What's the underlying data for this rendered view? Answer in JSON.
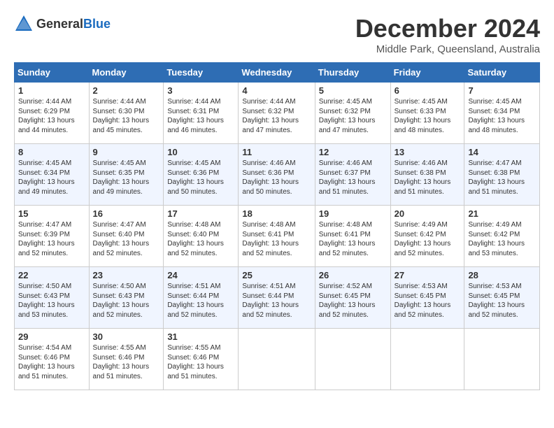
{
  "header": {
    "logo_general": "General",
    "logo_blue": "Blue",
    "title": "December 2024",
    "location": "Middle Park, Queensland, Australia"
  },
  "calendar": {
    "days_of_week": [
      "Sunday",
      "Monday",
      "Tuesday",
      "Wednesday",
      "Thursday",
      "Friday",
      "Saturday"
    ],
    "weeks": [
      [
        {
          "day": "",
          "content": ""
        },
        {
          "day": "2",
          "content": "Sunrise: 4:44 AM\nSunset: 6:30 PM\nDaylight: 13 hours\nand 45 minutes."
        },
        {
          "day": "3",
          "content": "Sunrise: 4:44 AM\nSunset: 6:31 PM\nDaylight: 13 hours\nand 46 minutes."
        },
        {
          "day": "4",
          "content": "Sunrise: 4:44 AM\nSunset: 6:32 PM\nDaylight: 13 hours\nand 47 minutes."
        },
        {
          "day": "5",
          "content": "Sunrise: 4:45 AM\nSunset: 6:32 PM\nDaylight: 13 hours\nand 47 minutes."
        },
        {
          "day": "6",
          "content": "Sunrise: 4:45 AM\nSunset: 6:33 PM\nDaylight: 13 hours\nand 48 minutes."
        },
        {
          "day": "7",
          "content": "Sunrise: 4:45 AM\nSunset: 6:34 PM\nDaylight: 13 hours\nand 48 minutes."
        }
      ],
      [
        {
          "day": "8",
          "content": "Sunrise: 4:45 AM\nSunset: 6:34 PM\nDaylight: 13 hours\nand 49 minutes."
        },
        {
          "day": "9",
          "content": "Sunrise: 4:45 AM\nSunset: 6:35 PM\nDaylight: 13 hours\nand 49 minutes."
        },
        {
          "day": "10",
          "content": "Sunrise: 4:45 AM\nSunset: 6:36 PM\nDaylight: 13 hours\nand 50 minutes."
        },
        {
          "day": "11",
          "content": "Sunrise: 4:46 AM\nSunset: 6:36 PM\nDaylight: 13 hours\nand 50 minutes."
        },
        {
          "day": "12",
          "content": "Sunrise: 4:46 AM\nSunset: 6:37 PM\nDaylight: 13 hours\nand 51 minutes."
        },
        {
          "day": "13",
          "content": "Sunrise: 4:46 AM\nSunset: 6:38 PM\nDaylight: 13 hours\nand 51 minutes."
        },
        {
          "day": "14",
          "content": "Sunrise: 4:47 AM\nSunset: 6:38 PM\nDaylight: 13 hours\nand 51 minutes."
        }
      ],
      [
        {
          "day": "15",
          "content": "Sunrise: 4:47 AM\nSunset: 6:39 PM\nDaylight: 13 hours\nand 52 minutes."
        },
        {
          "day": "16",
          "content": "Sunrise: 4:47 AM\nSunset: 6:40 PM\nDaylight: 13 hours\nand 52 minutes."
        },
        {
          "day": "17",
          "content": "Sunrise: 4:48 AM\nSunset: 6:40 PM\nDaylight: 13 hours\nand 52 minutes."
        },
        {
          "day": "18",
          "content": "Sunrise: 4:48 AM\nSunset: 6:41 PM\nDaylight: 13 hours\nand 52 minutes."
        },
        {
          "day": "19",
          "content": "Sunrise: 4:48 AM\nSunset: 6:41 PM\nDaylight: 13 hours\nand 52 minutes."
        },
        {
          "day": "20",
          "content": "Sunrise: 4:49 AM\nSunset: 6:42 PM\nDaylight: 13 hours\nand 52 minutes."
        },
        {
          "day": "21",
          "content": "Sunrise: 4:49 AM\nSunset: 6:42 PM\nDaylight: 13 hours\nand 53 minutes."
        }
      ],
      [
        {
          "day": "22",
          "content": "Sunrise: 4:50 AM\nSunset: 6:43 PM\nDaylight: 13 hours\nand 53 minutes."
        },
        {
          "day": "23",
          "content": "Sunrise: 4:50 AM\nSunset: 6:43 PM\nDaylight: 13 hours\nand 52 minutes."
        },
        {
          "day": "24",
          "content": "Sunrise: 4:51 AM\nSunset: 6:44 PM\nDaylight: 13 hours\nand 52 minutes."
        },
        {
          "day": "25",
          "content": "Sunrise: 4:51 AM\nSunset: 6:44 PM\nDaylight: 13 hours\nand 52 minutes."
        },
        {
          "day": "26",
          "content": "Sunrise: 4:52 AM\nSunset: 6:45 PM\nDaylight: 13 hours\nand 52 minutes."
        },
        {
          "day": "27",
          "content": "Sunrise: 4:53 AM\nSunset: 6:45 PM\nDaylight: 13 hours\nand 52 minutes."
        },
        {
          "day": "28",
          "content": "Sunrise: 4:53 AM\nSunset: 6:45 PM\nDaylight: 13 hours\nand 52 minutes."
        }
      ],
      [
        {
          "day": "29",
          "content": "Sunrise: 4:54 AM\nSunset: 6:46 PM\nDaylight: 13 hours\nand 51 minutes."
        },
        {
          "day": "30",
          "content": "Sunrise: 4:55 AM\nSunset: 6:46 PM\nDaylight: 13 hours\nand 51 minutes."
        },
        {
          "day": "31",
          "content": "Sunrise: 4:55 AM\nSunset: 6:46 PM\nDaylight: 13 hours\nand 51 minutes."
        },
        {
          "day": "",
          "content": ""
        },
        {
          "day": "",
          "content": ""
        },
        {
          "day": "",
          "content": ""
        },
        {
          "day": "",
          "content": ""
        }
      ]
    ],
    "week1_day1": {
      "day": "1",
      "content": "Sunrise: 4:44 AM\nSunset: 6:29 PM\nDaylight: 13 hours\nand 44 minutes."
    }
  }
}
